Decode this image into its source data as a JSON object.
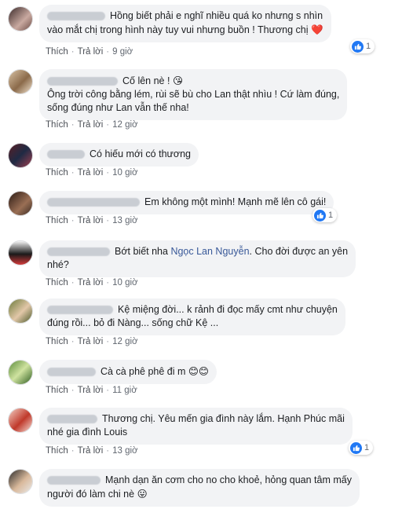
{
  "actions": {
    "like": "Thích",
    "reply": "Trả lời",
    "separator": "·"
  },
  "colors": {
    "bubble": "#f2f3f5",
    "like_blue": "#2078f4",
    "mention": "#385898",
    "heart": "#e8332f"
  },
  "comments": [
    {
      "text": "Hồng biết phải e nghĩ nhiều quá ko nhưng s nhìn\nvào mắt chị trong hình này tuy vui nhưng buồn ! Thương chị",
      "emoji": "❤️",
      "time": "9 giờ",
      "reactions": "1"
    },
    {
      "text": "Cố lên nè !",
      "emoji": "😘",
      "text2": "Ông trời công bằng lém, rùi sẽ bù cho Lan thật nhìu ! Cứ làm đúng,\nsống đúng như Lan vẫn thế nha!",
      "time": "12 giờ"
    },
    {
      "text": "Có hiếu mới có thương",
      "time": "10 giờ"
    },
    {
      "text": "Em không một mình! Mạnh mẽ lên cô gái!",
      "time": "13 giờ",
      "reactions": "1"
    },
    {
      "text": "Bớt biết nha",
      "mention": "Ngọc Lan Nguyễn",
      "text2": ". Cho đời được an yên\nnhé?",
      "time": "10 giờ"
    },
    {
      "text": "Kệ miệng đời... k rảnh đi đọc mấy cmt như chuyện\nđúng rồi... bỏ đi Nàng... sống chữ Kệ ...",
      "time": "12 giờ"
    },
    {
      "text": "Cà cà phê phê đi m",
      "emoji": "😊😊",
      "time": "11 giờ"
    },
    {
      "text": "Thương chị. Yêu mến gia đình này lắm. Hạnh Phúc mãi\nnhé gia đình Louis",
      "time": "13 giờ",
      "reactions": "1"
    },
    {
      "text": "Mạnh dạn ăn cơm cho no cho khoẻ, hỏng quan tâm mấy\nngười đó làm chi nè",
      "emoji": "😛"
    }
  ]
}
